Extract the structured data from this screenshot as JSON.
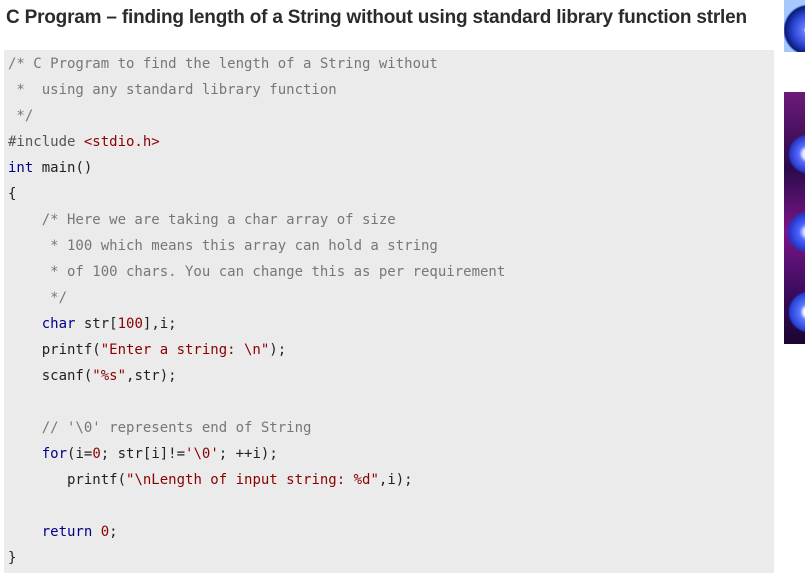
{
  "page": {
    "title": "C Program – finding length of a String without using standard library function strlen"
  },
  "code": {
    "lines": [
      {
        "segments": [
          {
            "cls": "cm",
            "text": "/* C Program to find the length of a String without"
          }
        ]
      },
      {
        "segments": [
          {
            "cls": "cm",
            "text": " *  using any standard library function"
          }
        ]
      },
      {
        "segments": [
          {
            "cls": "cm",
            "text": " */"
          }
        ]
      },
      {
        "segments": [
          {
            "cls": "pp",
            "text": "#include "
          },
          {
            "cls": "str",
            "text": "<stdio.h>"
          }
        ]
      },
      {
        "segments": [
          {
            "cls": "kw",
            "text": "int"
          },
          {
            "cls": "tx",
            "text": " main()"
          }
        ]
      },
      {
        "segments": [
          {
            "cls": "tx",
            "text": "{"
          }
        ]
      },
      {
        "segments": [
          {
            "cls": "cm",
            "text": "    /* Here we are taking a char array of size"
          }
        ]
      },
      {
        "segments": [
          {
            "cls": "cm",
            "text": "     * 100 which means this array can hold a string"
          }
        ]
      },
      {
        "segments": [
          {
            "cls": "cm",
            "text": "     * of 100 chars. You can change this as per requirement"
          }
        ]
      },
      {
        "segments": [
          {
            "cls": "cm",
            "text": "     */"
          }
        ]
      },
      {
        "segments": [
          {
            "cls": "kw",
            "text": "    char"
          },
          {
            "cls": "tx",
            "text": " str["
          },
          {
            "cls": "num",
            "text": "100"
          },
          {
            "cls": "tx",
            "text": "],i;"
          }
        ]
      },
      {
        "segments": [
          {
            "cls": "tx",
            "text": "    printf("
          },
          {
            "cls": "str",
            "text": "\"Enter a string: \\n\""
          },
          {
            "cls": "tx",
            "text": ");"
          }
        ]
      },
      {
        "segments": [
          {
            "cls": "tx",
            "text": "    scanf("
          },
          {
            "cls": "str",
            "text": "\"%s\""
          },
          {
            "cls": "tx",
            "text": ",str);"
          }
        ]
      },
      {
        "segments": [
          {
            "cls": "tx",
            "text": ""
          }
        ]
      },
      {
        "segments": [
          {
            "cls": "cm",
            "text": "    // '\\0' represents end of String"
          }
        ]
      },
      {
        "segments": [
          {
            "cls": "kw",
            "text": "    for"
          },
          {
            "cls": "tx",
            "text": "(i="
          },
          {
            "cls": "num",
            "text": "0"
          },
          {
            "cls": "tx",
            "text": "; str[i]!="
          },
          {
            "cls": "str",
            "text": "'\\0'"
          },
          {
            "cls": "tx",
            "text": "; ++i);"
          }
        ]
      },
      {
        "segments": [
          {
            "cls": "tx",
            "text": "       printf("
          },
          {
            "cls": "str",
            "text": "\"\\nLength of input string: %d\""
          },
          {
            "cls": "tx",
            "text": ",i);"
          }
        ]
      },
      {
        "segments": [
          {
            "cls": "tx",
            "text": ""
          }
        ]
      },
      {
        "segments": [
          {
            "cls": "kw",
            "text": "    return"
          },
          {
            "cls": "tx",
            "text": " "
          },
          {
            "cls": "num",
            "text": "0"
          },
          {
            "cls": "tx",
            "text": ";"
          }
        ]
      },
      {
        "segments": [
          {
            "cls": "tx",
            "text": "}"
          }
        ]
      }
    ]
  }
}
